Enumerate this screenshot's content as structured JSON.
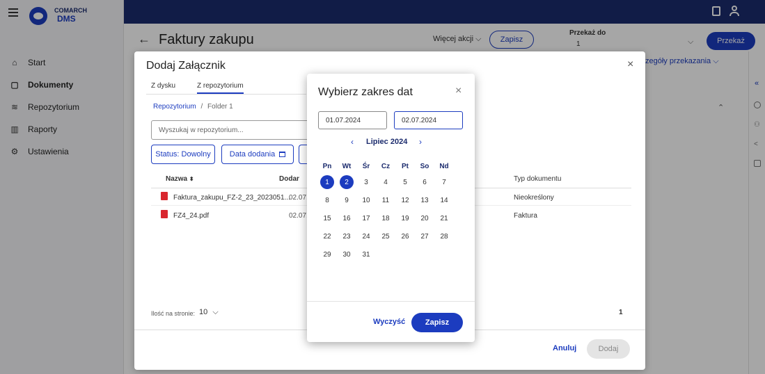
{
  "app": {
    "brand_top": "COMARCH",
    "brand_bottom": "DMS"
  },
  "sidebar": {
    "items": [
      {
        "label": "Start"
      },
      {
        "label": "Dokumenty"
      },
      {
        "label": "Repozytorium"
      },
      {
        "label": "Raporty"
      },
      {
        "label": "Ustawienia"
      }
    ]
  },
  "header": {
    "title": "Faktury zakupu",
    "more_actions": "Więcej akcji",
    "save": "Zapisz",
    "forward_to_label": "Przekaż do",
    "forward_to_value": "1",
    "forward": "Przekaż",
    "details": "zegóły przekazania"
  },
  "dialog": {
    "title": "Dodaj Załącznik",
    "tabs": [
      "Z dysku",
      "Z repozytorium"
    ],
    "breadcrumb_root": "Repozytorium",
    "breadcrumb_sep": "/",
    "breadcrumb_folder": "Folder 1",
    "search_placeholder": "Wyszukaj w repozytorium...",
    "filter_status": "Status: Dowolny",
    "filter_date": "Data dodania",
    "columns": {
      "name": "Nazwa",
      "added": "Dodar",
      "type": "Typ dokumentu"
    },
    "rows": [
      {
        "name": "Faktura_zakupu_FZ-2_23_2023051...",
        "added": "02.07.",
        "type": "Nieokreślony"
      },
      {
        "name": "FZ4_24.pdf",
        "added": "02.07.",
        "type": "Faktura"
      }
    ],
    "per_page_label": "Ilość na stronie:",
    "per_page_value": "10",
    "page_number": "1",
    "cancel": "Anuluj",
    "add": "Dodaj"
  },
  "picker": {
    "title": "Wybierz zakres dat",
    "date_from": "01.07.2024",
    "date_to": "02.07.2024",
    "month": "Lipiec 2024",
    "weekdays": [
      "Pn",
      "Wt",
      "Śr",
      "Cz",
      "Pt",
      "So",
      "Nd"
    ],
    "weeks": [
      [
        "1",
        "2",
        "3",
        "4",
        "5",
        "6",
        "7"
      ],
      [
        "8",
        "9",
        "10",
        "11",
        "12",
        "13",
        "14"
      ],
      [
        "15",
        "16",
        "17",
        "18",
        "19",
        "20",
        "21"
      ],
      [
        "22",
        "23",
        "24",
        "25",
        "26",
        "27",
        "28"
      ],
      [
        "29",
        "30",
        "31",
        "",
        "",
        "",
        ""
      ]
    ],
    "selected": [
      "1",
      "2"
    ],
    "clear": "Wyczyść",
    "save": "Zapisz"
  },
  "colors": {
    "navy": "#1b2b6d",
    "accent": "#1c3cbf"
  }
}
